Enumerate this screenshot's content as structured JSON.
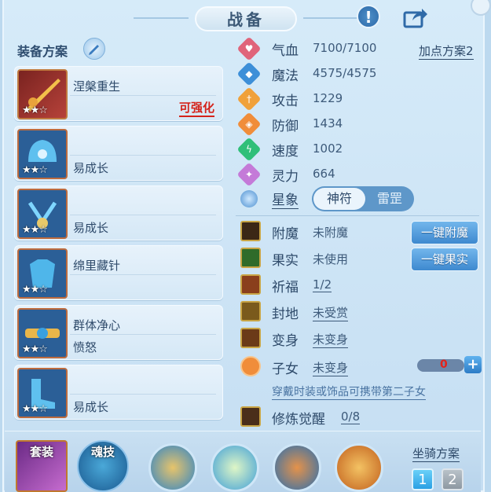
{
  "header": {
    "title": "战备",
    "alert_icon": "exclamation-icon",
    "share_icon": "share-icon"
  },
  "left": {
    "title": "装备方案",
    "cards": [
      {
        "name": "涅槃重生",
        "sub": "",
        "action": "可强化",
        "stars": "★★☆"
      },
      {
        "name": "",
        "sub": "易成长",
        "action": "",
        "stars": "★★☆"
      },
      {
        "name": "",
        "sub": "易成长",
        "action": "",
        "stars": "★★☆"
      },
      {
        "name": "绵里藏针",
        "sub": "",
        "action": "",
        "stars": "★★☆"
      },
      {
        "name": "群体净心",
        "sub": "愤怒",
        "action": "",
        "stars": "★★☆"
      },
      {
        "name": "",
        "sub": "易成长",
        "action": "",
        "stars": "★★☆"
      }
    ]
  },
  "stats": [
    {
      "label": "气血",
      "value": "7100/7100",
      "color": "#e0647a"
    },
    {
      "label": "魔法",
      "value": "4575/4575",
      "color": "#3d8fd8"
    },
    {
      "label": "攻击",
      "value": "1229",
      "color": "#f0a13a"
    },
    {
      "label": "防御",
      "value": "1434",
      "color": "#f08d3a"
    },
    {
      "label": "速度",
      "value": "1002",
      "color": "#2fbf79"
    },
    {
      "label": "灵力",
      "value": "664",
      "color": "#c47ad8"
    }
  ],
  "add_point_plan": "加点方案2",
  "star_sign": {
    "label": "星象",
    "options": [
      "神符",
      "雷罡"
    ]
  },
  "rows": [
    {
      "label": "附魔",
      "value": "未附魔",
      "underline": false
    },
    {
      "label": "果实",
      "value": "未使用",
      "underline": false
    },
    {
      "label": "祈福",
      "value": "1/2",
      "underline": true
    },
    {
      "label": "封地",
      "value": "未受赏",
      "underline": true
    },
    {
      "label": "变身",
      "value": "未变身",
      "underline": true
    },
    {
      "label": "子女",
      "value": "未变身",
      "underline": true
    },
    {
      "label": "修炼觉醒",
      "value": "0/8",
      "underline": true
    }
  ],
  "buttons": {
    "enchant": "一键附魔",
    "fruit": "一键果实"
  },
  "child": {
    "count": "0",
    "plus": "+"
  },
  "hint": "穿戴时装或饰品可携带第二子女",
  "bottom": {
    "suit": "套装",
    "soul": "魂技",
    "mount_label": "坐骑方案",
    "mount_options": [
      "1",
      "2"
    ]
  }
}
